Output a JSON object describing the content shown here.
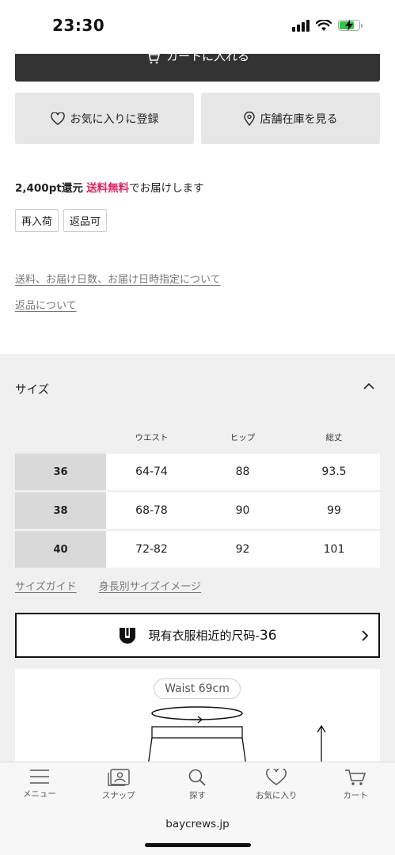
{
  "status_bar": {
    "time": "23:30"
  },
  "product": {
    "cart_label": "カートに入れる",
    "favorite_label": "お気に入りに登録",
    "store_stock_label": "店舗在庫を見る",
    "points": "2,400pt還元",
    "free_shipping": "送料無料",
    "shipping_suffix": "でお届けします",
    "tags": [
      "再入荷",
      "返品可"
    ],
    "links": {
      "shipping": "送料、お届け日数、お届け日時指定について",
      "returns": "返品について"
    }
  },
  "size": {
    "title": "サイズ",
    "columns": [
      "",
      "ウエスト",
      "ヒップ",
      "総丈"
    ],
    "rows": [
      {
        "label": "36",
        "waist": "64-74",
        "hip": "88",
        "length": "93.5"
      },
      {
        "label": "38",
        "waist": "68-78",
        "hip": "90",
        "length": "99"
      },
      {
        "label": "40",
        "waist": "72-82",
        "hip": "92",
        "length": "101"
      }
    ],
    "guide_link": "サイズガイド",
    "height_link": "身長別サイズイメージ",
    "fit_label": "現有衣服相近的尺码-",
    "fit_size": "36",
    "waist_label": "Waist 69cm"
  },
  "bottom_nav": {
    "items": [
      {
        "label": "メニュー",
        "icon": "menu-icon"
      },
      {
        "label": "スナップ",
        "icon": "snap-icon"
      },
      {
        "label": "探す",
        "icon": "search-icon"
      },
      {
        "label": "お気に入り",
        "icon": "heart-icon"
      },
      {
        "label": "カート",
        "icon": "cart-icon"
      }
    ]
  },
  "browser": {
    "url": "baycrews.jp"
  },
  "colors": {
    "accent": "#e0245e",
    "button_dark": "#333333",
    "panel_bg": "#f0f0f0"
  }
}
